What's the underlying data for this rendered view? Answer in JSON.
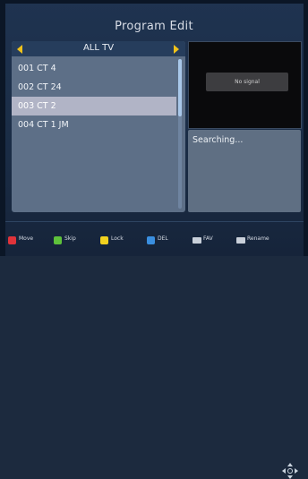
{
  "header": {
    "title": "Program Edit"
  },
  "category": {
    "label": "ALL TV"
  },
  "channels": [
    {
      "label": "001 CT 4",
      "selected": false
    },
    {
      "label": "002 CT 24",
      "selected": false
    },
    {
      "label": "003 CT 2",
      "selected": true
    },
    {
      "label": "004 CT 1 JM",
      "selected": false
    }
  ],
  "preview": {
    "status": "No signal"
  },
  "info": {
    "text": "Searching..."
  },
  "buttons": [
    {
      "label": "Move",
      "color": "#e0333a",
      "icon": "red-key-icon"
    },
    {
      "label": "Skip",
      "color": "#5ec23b",
      "icon": "green-key-icon"
    },
    {
      "label": "Lock",
      "color": "#f2d21f",
      "icon": "yellow-key-icon"
    },
    {
      "label": "DEL",
      "color": "#3a8fe0",
      "icon": "blue-key-icon"
    },
    {
      "label": "FAV",
      "color": "#c9d0da",
      "icon": "fav-key-icon"
    },
    {
      "label": "Rename",
      "color": "#c9d0da",
      "icon": "rename-key-icon"
    }
  ],
  "nav": {
    "icon": "dpad-icon"
  }
}
